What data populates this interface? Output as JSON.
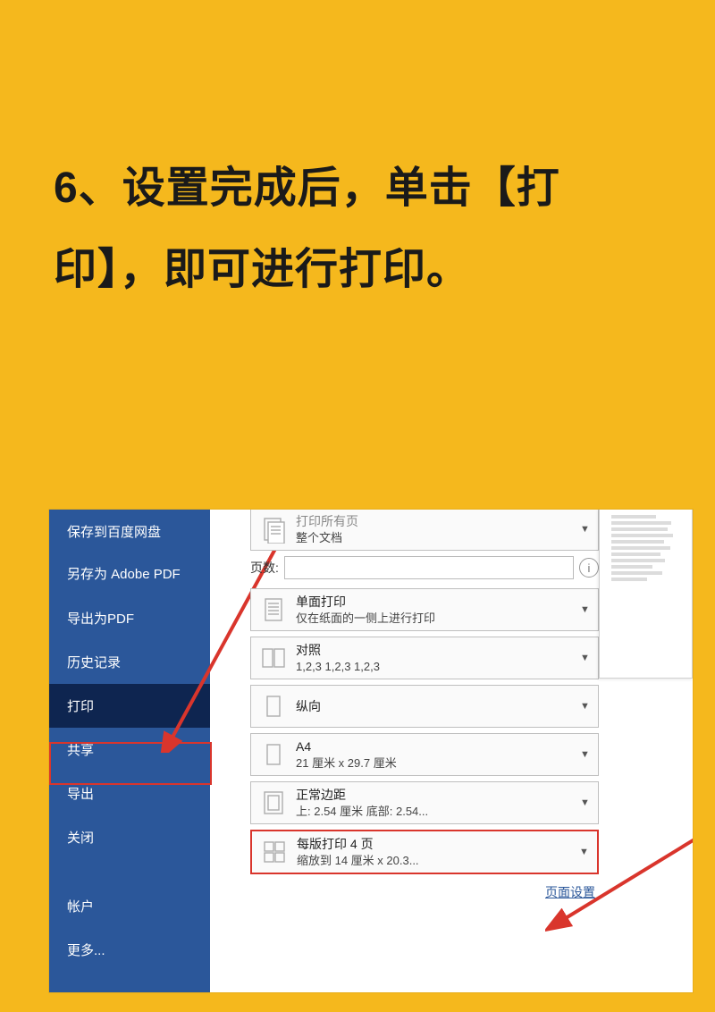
{
  "instruction": "6、设置完成后，单击【打印】，即可进行打印。",
  "sidebar": {
    "items": [
      {
        "label": "保存到百度网盘"
      },
      {
        "label": "另存为 Adobe PDF"
      },
      {
        "label": "导出为PDF"
      },
      {
        "label": "历史记录"
      },
      {
        "label": "打印",
        "selected": true
      },
      {
        "label": "共享"
      },
      {
        "label": "导出"
      },
      {
        "label": "关闭"
      },
      {
        "label": "帐户"
      },
      {
        "label": "更多..."
      }
    ]
  },
  "settings": {
    "print_range": {
      "title": "打印所有页",
      "sub": "整个文档"
    },
    "pages_label": "页数:",
    "pages_value": "",
    "sides": {
      "title": "单面打印",
      "sub": "仅在纸面的一侧上进行打印"
    },
    "collate": {
      "title": "对照",
      "sub": "1,2,3    1,2,3    1,2,3"
    },
    "orientation": {
      "title": "纵向"
    },
    "paper": {
      "title": "A4",
      "sub": "21 厘米 x 29.7 厘米"
    },
    "margins": {
      "title": "正常边距",
      "sub": "上: 2.54 厘米 底部: 2.54..."
    },
    "persheet": {
      "title": "每版打印 4 页",
      "sub": "缩放到 14 厘米 x 20.3..."
    },
    "page_setup_link": "页面设置"
  }
}
